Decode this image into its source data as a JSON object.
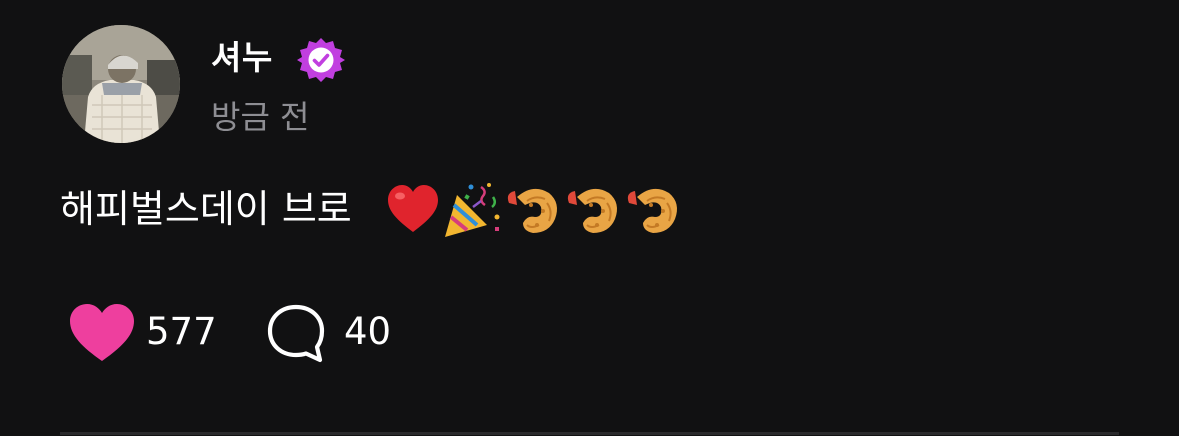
{
  "author": {
    "name": "셔누",
    "verified": true,
    "badge_color": "#c13fe0"
  },
  "post": {
    "timestamp": "방금 전",
    "text": "해피벌스데이 브로",
    "emojis": [
      "heart-emoji",
      "party-popper-emoji",
      "shrimp-emoji",
      "shrimp-emoji",
      "shrimp-emoji"
    ]
  },
  "actions": {
    "likes": "577",
    "comments": "40",
    "like_color": "#ee3f9e"
  }
}
